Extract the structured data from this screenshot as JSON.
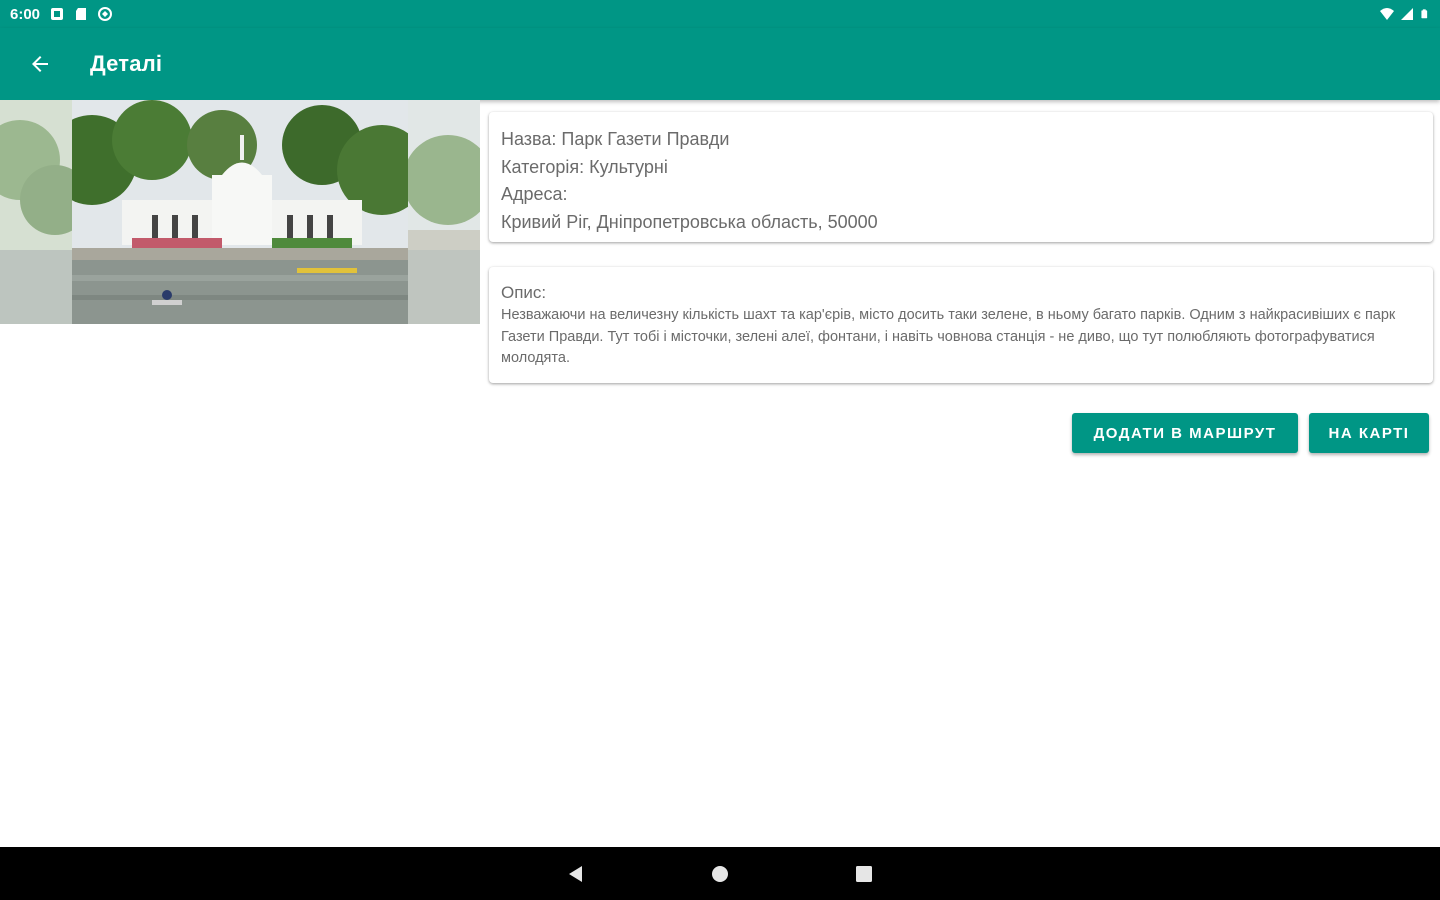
{
  "status_bar": {
    "time": "6:00",
    "icons_left": [
      "notification-icon",
      "sd-card-icon",
      "sync-icon"
    ],
    "icons_right": [
      "wifi-icon",
      "signal-icon",
      "battery-icon"
    ]
  },
  "app_bar": {
    "title": "Деталі",
    "back_icon": "arrow-back-icon",
    "background": "#009685"
  },
  "place": {
    "name_line": "Назва: Парк Газети Правди",
    "category_line": "Категорія: Культурні",
    "address_label": "Адреса:",
    "address_value": "Кривий Ріг, Дніпропетровська область, 50000"
  },
  "description": {
    "label": "Опис:",
    "text": "Незважаючи на величезну кількість шахт та кар'єрів, місто досить таки зелене, в ньому багато парків. Одним з найкрасивіших є парк Газети Правди. Тут тобі і місточки, зелені алеї, фонтани, і навіть човнова станція - не диво, що тут полюбляють фотографуватися молодята."
  },
  "actions": {
    "add_to_route": "Додати в маршрут",
    "on_map": "На карті"
  },
  "nav_bar": {
    "icons": [
      "back-triangle-icon",
      "home-circle-icon",
      "recents-square-icon"
    ]
  },
  "colors": {
    "accent": "#009685",
    "text_secondary": "#6b6b6b"
  }
}
